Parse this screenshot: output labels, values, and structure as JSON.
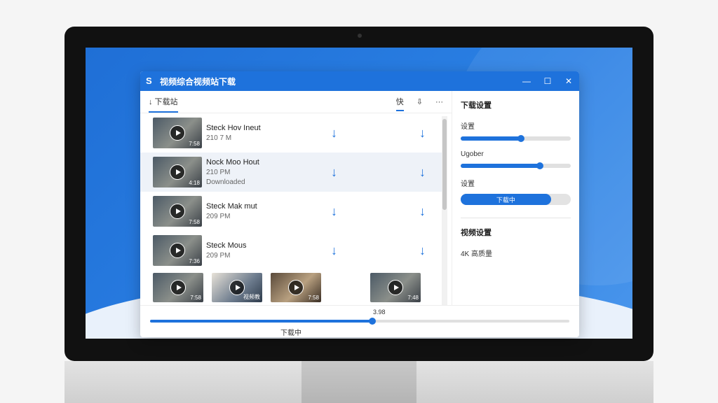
{
  "window": {
    "title": "视频综合视频站下载",
    "logo": "S",
    "min": "—",
    "max": "☐",
    "close": "✕"
  },
  "toolbar": {
    "tab_label": "↓ 下载站",
    "icon1": "快",
    "icon2": "⇩",
    "more": "···"
  },
  "videos": [
    {
      "title": "Steck Hov Ineut",
      "size": "210 7 M",
      "status": "",
      "duration": "7:58"
    },
    {
      "title": "Nock Moo Hout",
      "size": "210 PM",
      "status": "Downloaded",
      "duration": "4:18"
    },
    {
      "title": "Steck Mak mut",
      "size": "209 PM",
      "status": "",
      "duration": "7:58"
    },
    {
      "title": "Steck Mous",
      "size": "209 PM",
      "status": "",
      "duration": "7:36"
    }
  ],
  "thumb_row": [
    {
      "duration": "7:58"
    },
    {
      "duration": "视频教"
    },
    {
      "duration": "7:58"
    },
    {
      "duration": "7:48"
    }
  ],
  "right_panel": {
    "title": "下载设置",
    "setting1_label": "设置",
    "setting1_value": 0.55,
    "setting2_label": "Ugober",
    "setting2_value": 0.72,
    "setting3_label": "设置",
    "download_pill": "下载中",
    "section2_title": "视频设置",
    "quality": "4K 高质量"
  },
  "bottom": {
    "percent_label": "3.98",
    "progress": 0.53,
    "status": "下载中"
  },
  "colors": {
    "accent": "#1e72dc"
  }
}
